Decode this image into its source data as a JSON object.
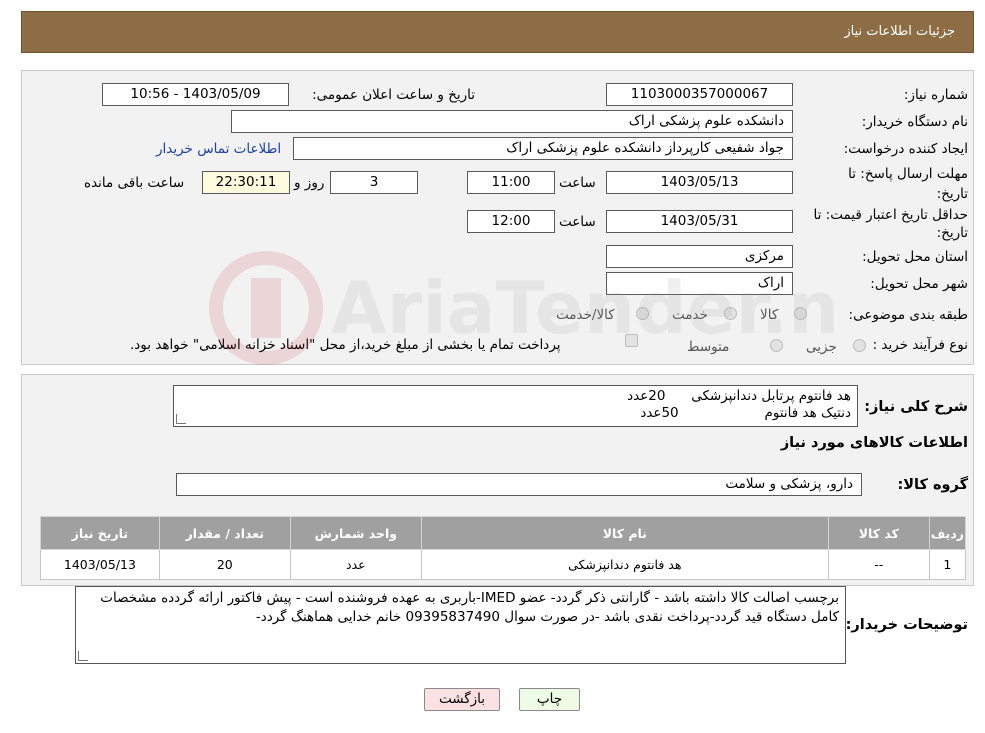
{
  "header": {
    "title": "جزئیات اطلاعات نیاز"
  },
  "labels": {
    "need_number": "شماره نیاز:",
    "announce_datetime": "تاریخ و ساعت اعلان عمومی:",
    "buyer_org": "نام دستگاه خریدار:",
    "requester": "ایجاد کننده درخواست:",
    "buyer_contact": "اطلاعات تماس خریدار",
    "response_deadline_line1": "مهلت ارسال پاسخ: تا",
    "response_deadline_line2": "تاریخ:",
    "time": "ساعت",
    "days_and": "روز و",
    "remaining": "ساعت باقی مانده",
    "min_validity_line1": "حداقل تاریخ اعتبار قیمت: تا",
    "min_validity_line2": "تاریخ:",
    "province": "استان محل تحویل:",
    "city": "شهر محل تحویل:",
    "category": "طبقه بندی موضوعی:",
    "purchase_type": "نوع فرآیند خرید :",
    "summary": "شرح کلی نیاز:",
    "goods_info": "اطلاعات کالاهای مورد نیاز",
    "goods_group": "گروه کالا:",
    "buyer_notes": "توضیحات خریدار:"
  },
  "values": {
    "need_number": "1103000357000067",
    "announce_datetime": "1403/05/09 - 10:56",
    "buyer_org": "دانشکده علوم پزشکی اراک",
    "requester": "جواد شفیعی کارپرداز دانشکده علوم پزشکی اراک",
    "response_date": "1403/05/13",
    "response_time": "11:00",
    "days": "3",
    "remaining_time": "22:30:11",
    "validity_date": "1403/05/31",
    "validity_time": "12:00",
    "province": "مرکزی",
    "city": "اراک",
    "summary_line1": "هد فانتوم پرتابل دندانپزشکی      20عدد",
    "summary_line2": "دنتیک هد فانتوم                    50عدد",
    "goods_group": "دارو، پزشکی و سلامت",
    "buyer_notes": "برچسب اصالت کالا داشته باشد - گارانتی ذکر گردد- عضو IMED-باربری به عهده فروشنده است - پیش فاکتور ارائه گردده مشخصات کامل دستگاه قید گردد-پرداخت نقدی باشد -در صورت سوال 09395837490  خانم خدایی هماهنگ گردد-"
  },
  "category_options": [
    "کالا",
    "خدمت",
    "کالا/خدمت"
  ],
  "purchase_options": [
    "جزیی",
    "متوسط"
  ],
  "payment_note": "پرداخت تمام یا بخشی از مبلغ خرید،از محل \"اسناد خزانه اسلامی\" خواهد بود.",
  "table": {
    "headers": [
      "ردیف",
      "کد کالا",
      "نام کالا",
      "واحد شمارش",
      "تعداد / مقدار",
      "تاریخ نیاز"
    ],
    "rows": [
      [
        "1",
        "--",
        "هد فانتوم دندانپزشکی",
        "عدد",
        "20",
        "1403/05/13"
      ]
    ]
  },
  "buttons": {
    "print": "چاپ",
    "back": "بازگشت"
  },
  "watermark": "AriaTender.neT",
  "colors": {
    "header_bg": "#8d6d44",
    "table_header_bg": "#a0a0a0",
    "link": "#1a3fa8",
    "back_button_bg": "#fbe1e1"
  }
}
